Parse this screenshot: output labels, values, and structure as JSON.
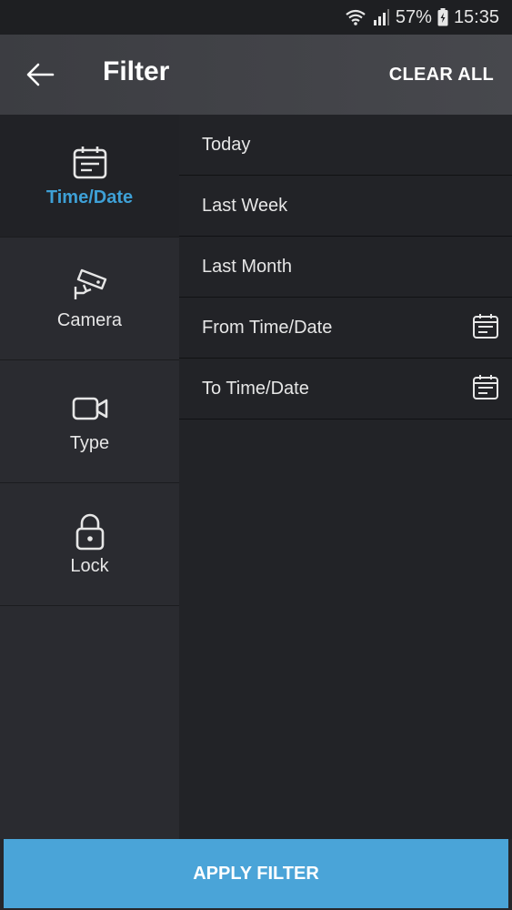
{
  "status_bar": {
    "battery_percent": "57%",
    "time": "15:35",
    "icons": [
      "wifi-icon",
      "signal-icon",
      "battery-icon"
    ]
  },
  "toolbar": {
    "back_icon": "arrow-left-icon",
    "title": "Filter",
    "clear_all_label": "CLEAR ALL"
  },
  "sidebar": {
    "items": [
      {
        "label": "Time/Date",
        "icon": "calendar-icon",
        "active": true
      },
      {
        "label": "Camera",
        "icon": "security-camera-icon",
        "active": false
      },
      {
        "label": "Type",
        "icon": "video-camera-icon",
        "active": false
      },
      {
        "label": "Lock",
        "icon": "lock-icon",
        "active": false
      }
    ]
  },
  "options": {
    "items": [
      {
        "label": "Today"
      },
      {
        "label": "Last Week"
      },
      {
        "label": "Last Month"
      },
      {
        "label": "From Time/Date",
        "icon": "calendar-icon"
      },
      {
        "label": "To Time/Date",
        "icon": "calendar-icon"
      }
    ]
  },
  "apply": {
    "label": "APPLY FILTER"
  },
  "colors": {
    "accent": "#3ea0d6",
    "apply_button": "#4aa4d8",
    "background": "#25262b"
  }
}
